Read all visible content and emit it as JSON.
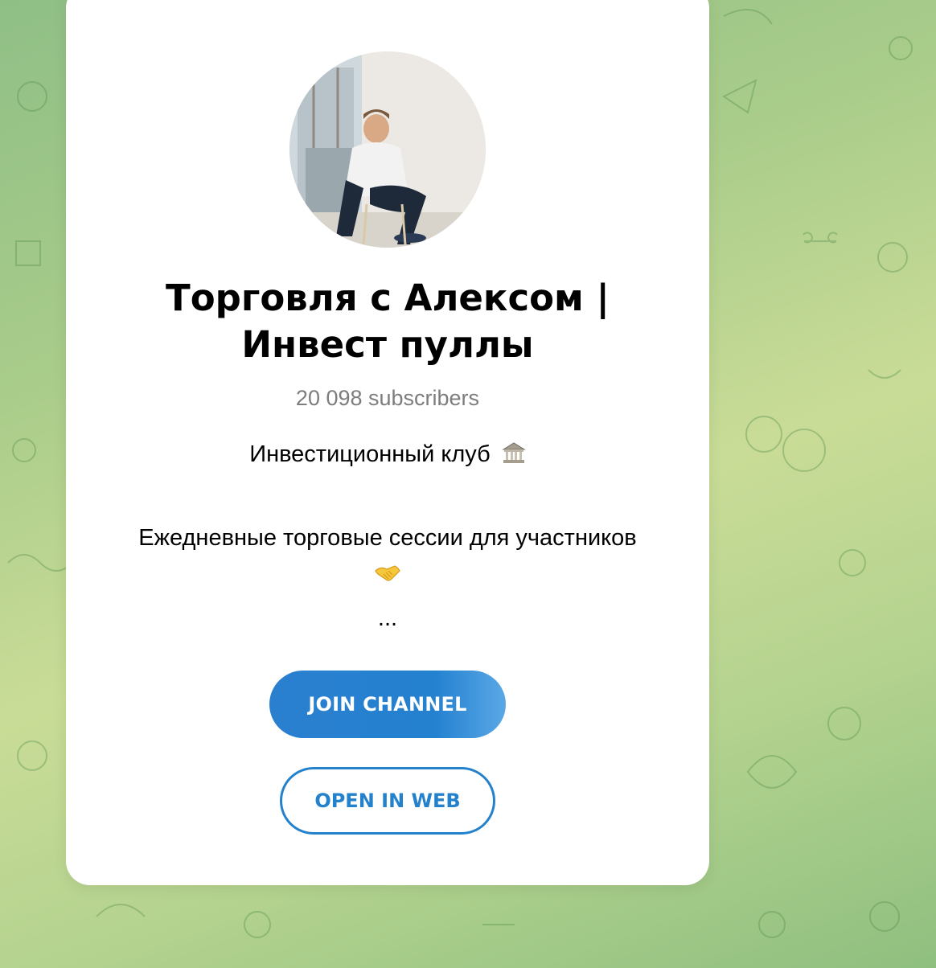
{
  "channel": {
    "title": "Торговля с Алексом | Инвест пуллы",
    "subscribers": "20 098 subscribers",
    "description_line1": "Инвестиционный клуб",
    "description_line1_emoji": "bank-building-emoji",
    "description_line2": "Ежедневные торговые сессии для участников",
    "description_line2_emoji": "handshake-emoji",
    "description_more": "..."
  },
  "buttons": {
    "join_label": "JOIN CHANNEL",
    "open_web_label": "OPEN IN WEB"
  },
  "colors": {
    "accent": "#2481cc",
    "background_green": "#a9cc8a",
    "subtitle_gray": "#7d7d7d"
  }
}
